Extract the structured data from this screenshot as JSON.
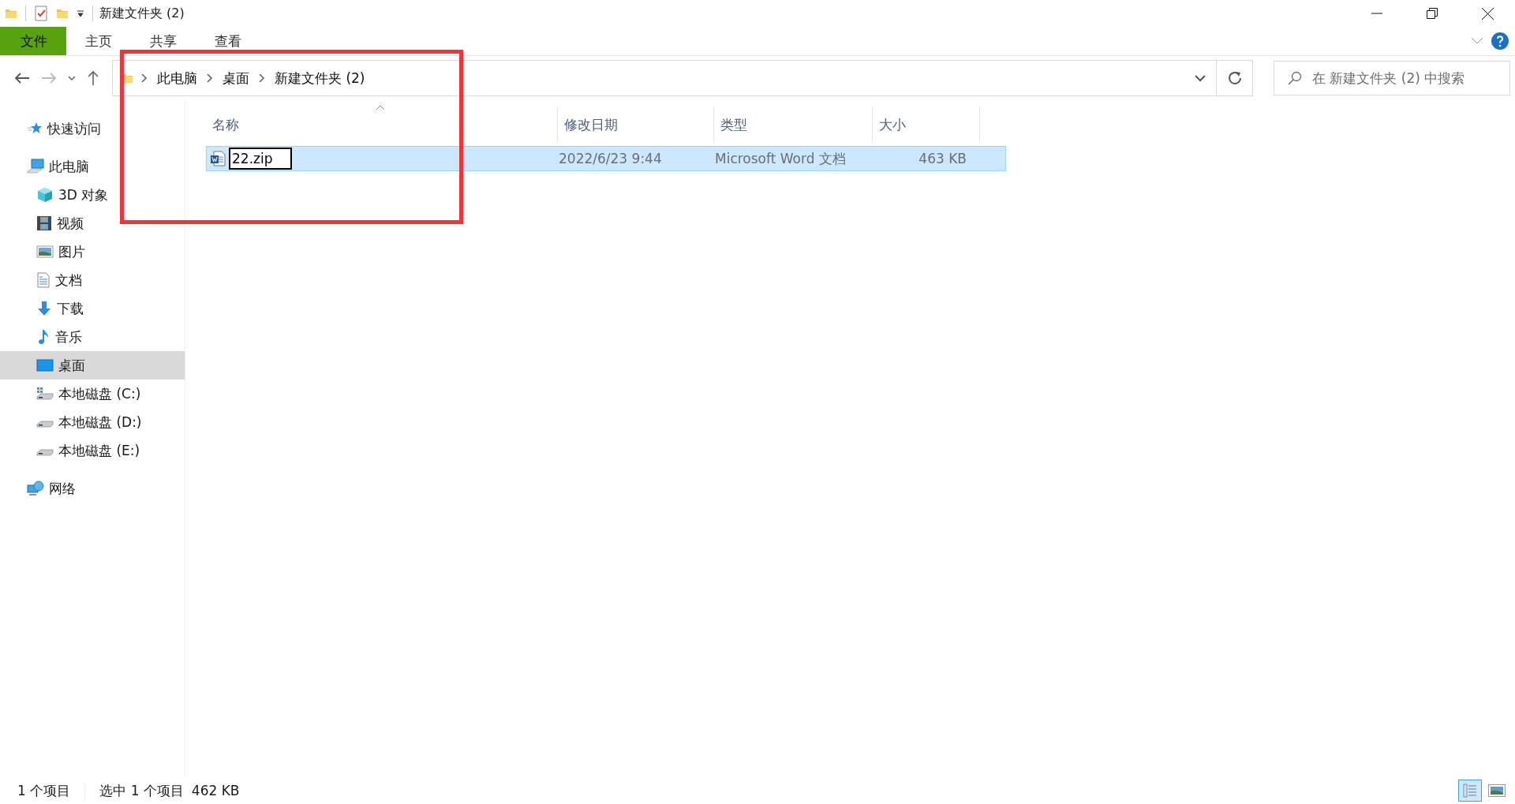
{
  "window": {
    "title": "新建文件夹 (2)"
  },
  "ribbon_tabs": [
    {
      "label": "文件",
      "kind": "file"
    },
    {
      "label": "主页",
      "kind": "tab"
    },
    {
      "label": "共享",
      "kind": "tab"
    },
    {
      "label": "查看",
      "kind": "tab"
    }
  ],
  "address": {
    "path": [
      "此电脑",
      "桌面",
      "新建文件夹 (2)"
    ]
  },
  "search": {
    "placeholder": "在 新建文件夹 (2) 中搜索"
  },
  "nav": [
    {
      "label": "快速访问",
      "selected": false
    },
    {
      "label": "此电脑",
      "selected": false,
      "children": [
        {
          "label": "3D 对象",
          "selected": false
        },
        {
          "label": "视频",
          "selected": false
        },
        {
          "label": "图片",
          "selected": false
        },
        {
          "label": "文档",
          "selected": false
        },
        {
          "label": "下载",
          "selected": false
        },
        {
          "label": "音乐",
          "selected": false
        },
        {
          "label": "桌面",
          "selected": true
        },
        {
          "label": "本地磁盘 (C:)",
          "selected": false
        },
        {
          "label": "本地磁盘 (D:)",
          "selected": false
        },
        {
          "label": "本地磁盘 (E:)",
          "selected": false
        }
      ]
    },
    {
      "label": "网络",
      "selected": false
    }
  ],
  "columns": [
    {
      "label": "名称",
      "sorted": true
    },
    {
      "label": "修改日期",
      "sorted": false
    },
    {
      "label": "类型",
      "sorted": false
    },
    {
      "label": "大小",
      "sorted": false
    }
  ],
  "files": [
    {
      "name": "22.zip",
      "date": "2022/6/23 9:44",
      "type": "Microsoft Word 文档",
      "size": "463 KB",
      "selected": true,
      "renaming": true
    }
  ],
  "status_bar": {
    "count": "1 个项目",
    "selection": "选中 1 个项目",
    "selection_size": "462 KB"
  },
  "view_buttons": [
    {
      "selected": true
    },
    {
      "selected": false
    }
  ]
}
